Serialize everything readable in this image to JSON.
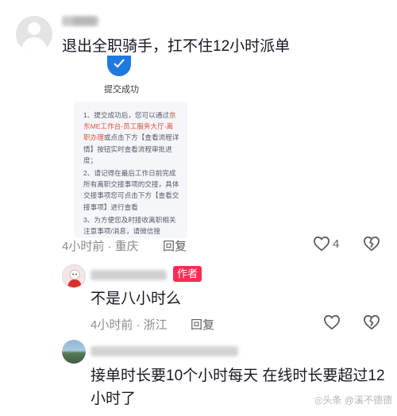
{
  "comments": [
    {
      "text": "退出全职骑手，扛不住12小时派单",
      "meta": "4小时前 · 重庆",
      "reply_label": "回复",
      "like_count": "4",
      "attachment": {
        "status_title": "提交成功",
        "steps": [
          [
            "1、提交成功后，您可以通过",
            "京东ME工作台-员工服务大厅-离职办理",
            "或点击下方【查看流程详情】按钮实时查看流程审批进度；"
          ],
          [
            "2、请记得在最后工作日前完成所有离职交接事项的交接，具体交接事项您可点击下方【查看交接事项】进行查看",
            "",
            ""
          ],
          [
            "3、为方便您及时接收离职相关注意事项/消息，请微信搜",
            "",
            ""
          ]
        ]
      }
    },
    {
      "author_badge": "作者",
      "text": "不是八小时么",
      "meta": "4小时前 · 浙江",
      "reply_label": "回复"
    },
    {
      "text_line1": "接单时长要10个小时每天 在线时长要超过12",
      "text_line2": "小时了"
    }
  ],
  "watermark": "◎头条 @溪不德德",
  "icons": {
    "check": "check-icon",
    "heart": "heart-outline-icon",
    "dislike": "broken-heart-icon",
    "reply": "reply-icon"
  }
}
